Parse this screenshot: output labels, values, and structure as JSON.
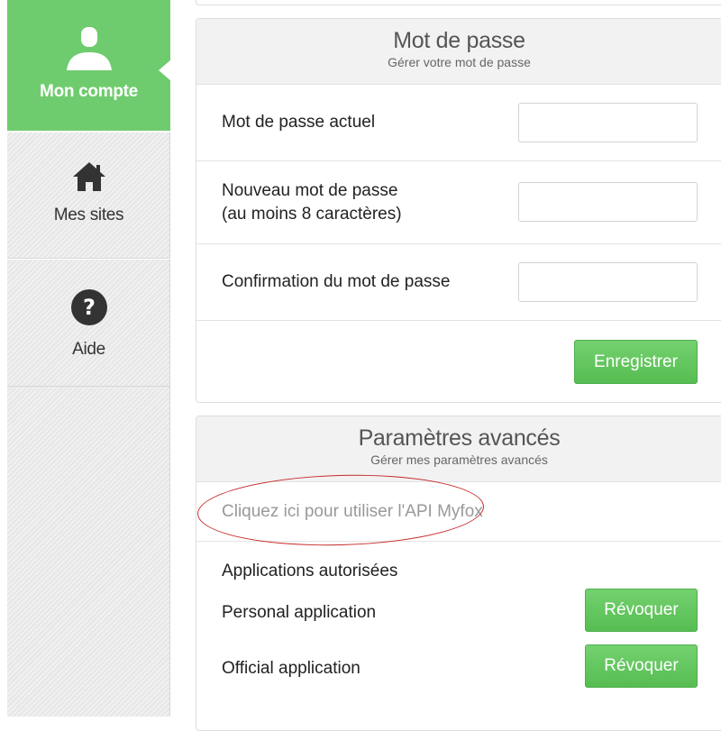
{
  "sidebar": {
    "items": [
      {
        "label": "Mon compte",
        "icon": "user-icon",
        "active": true
      },
      {
        "label": "Mes sites",
        "icon": "home-icon",
        "active": false
      },
      {
        "label": "Aide",
        "icon": "help-icon",
        "active": false
      }
    ]
  },
  "password_panel": {
    "title": "Mot de passe",
    "subtitle": "Gérer votre mot de passe",
    "current_label": "Mot de passe actuel",
    "current_value": "",
    "new_label_line1": "Nouveau mot de passe",
    "new_label_line2": "(au moins 8 caractères)",
    "new_value": "",
    "confirm_label": "Confirmation du mot de passe",
    "confirm_value": "",
    "save_label": "Enregistrer"
  },
  "advanced_panel": {
    "title": "Paramètres avancés",
    "subtitle": "Gérer mes paramètres avancés",
    "api_link": "Cliquez ici pour utiliser l'API Myfox",
    "apps_heading": "Applications autorisées",
    "apps": [
      {
        "name": "Personal application",
        "action": "Révoquer"
      },
      {
        "name": "Official application",
        "action": "Révoquer"
      }
    ]
  },
  "colors": {
    "accent_green": "#6fcc6e",
    "button_green": "#5cc558",
    "annotation_red": "#c62828"
  }
}
